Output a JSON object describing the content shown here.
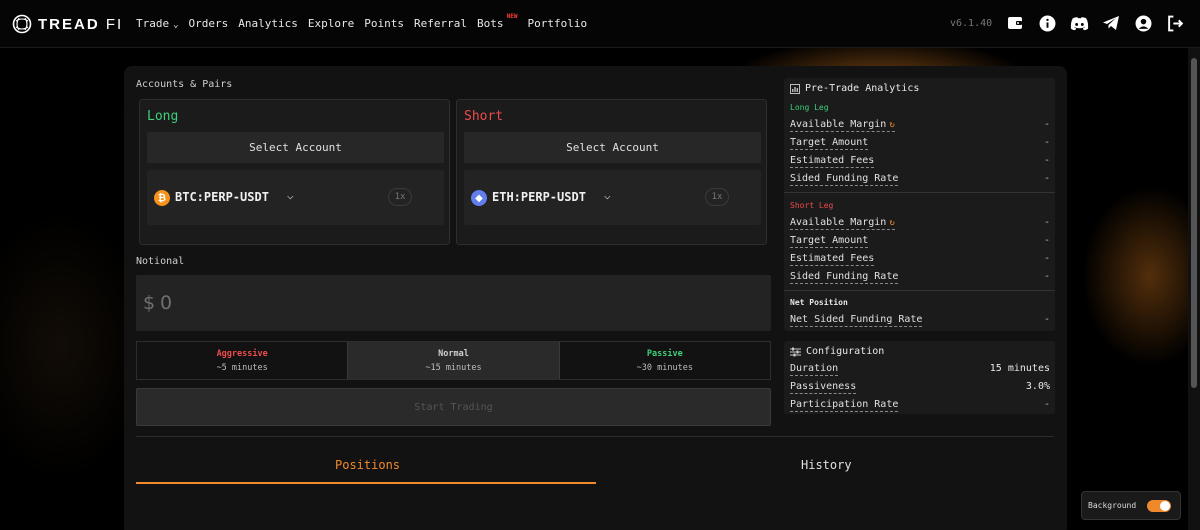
{
  "brand": {
    "logo_bold": "TREAD",
    "logo_light": "FI"
  },
  "nav": {
    "items": [
      "Trade",
      "Orders",
      "Analytics",
      "Explore",
      "Points",
      "Referral",
      "Bots",
      "Portfolio"
    ],
    "new_badge": "NEW"
  },
  "version": "v6.1.40",
  "header_icons": [
    "wallet-icon",
    "info-icon",
    "discord-icon",
    "telegram-icon",
    "user-icon",
    "logout-icon"
  ],
  "accounts": {
    "section_label": "Accounts & Pairs",
    "long": {
      "title": "Long",
      "select_label": "Select Account",
      "pair": "BTC:PERP-USDT",
      "coin_symbol": "₿",
      "leverage": "1x"
    },
    "short": {
      "title": "Short",
      "select_label": "Select Account",
      "pair": "ETH:PERP-USDT",
      "coin_symbol": "◆",
      "leverage": "1x"
    }
  },
  "notional": {
    "label": "Notional",
    "prefix": "$",
    "value": "0"
  },
  "strategies": [
    {
      "name": "Aggressive",
      "time": "~5 minutes",
      "color": "#ef4b4b",
      "selected": false
    },
    {
      "name": "Normal",
      "time": "~15 minutes",
      "color": "#cfcfcf",
      "selected": true
    },
    {
      "name": "Passive",
      "time": "~30 minutes",
      "color": "#3ecf7a",
      "selected": false
    }
  ],
  "start_button": "Start Trading",
  "tabs": {
    "positions": "Positions",
    "history": "History",
    "active": "positions"
  },
  "analytics": {
    "title": "Pre-Trade Analytics",
    "long_leg": {
      "heading": "Long Leg",
      "rows": [
        {
          "label": "Available Margin",
          "value": "-"
        },
        {
          "label": "Target Amount",
          "value": "-"
        },
        {
          "label": "Estimated Fees",
          "value": "-"
        },
        {
          "label": "Sided Funding Rate",
          "value": "-"
        }
      ]
    },
    "short_leg": {
      "heading": "Short Leg",
      "rows": [
        {
          "label": "Available Margin",
          "value": "-"
        },
        {
          "label": "Target Amount",
          "value": "-"
        },
        {
          "label": "Estimated Fees",
          "value": "-"
        },
        {
          "label": "Sided Funding Rate",
          "value": "-"
        }
      ]
    },
    "net": {
      "heading": "Net Position",
      "rows": [
        {
          "label": "Net Sided Funding Rate",
          "value": "-"
        }
      ]
    }
  },
  "configuration": {
    "title": "Configuration",
    "rows": [
      {
        "label": "Duration",
        "value": "15 minutes"
      },
      {
        "label": "Passiveness",
        "value": "3.0%"
      },
      {
        "label": "Participation Rate",
        "value": "-"
      }
    ]
  },
  "background_toggle": {
    "label": "Background",
    "on": true
  },
  "colors": {
    "accent": "#f0892b",
    "long": "#3ecf7a",
    "short": "#ef4b4b",
    "btc": "#f7931a",
    "eth": "#627eea"
  }
}
